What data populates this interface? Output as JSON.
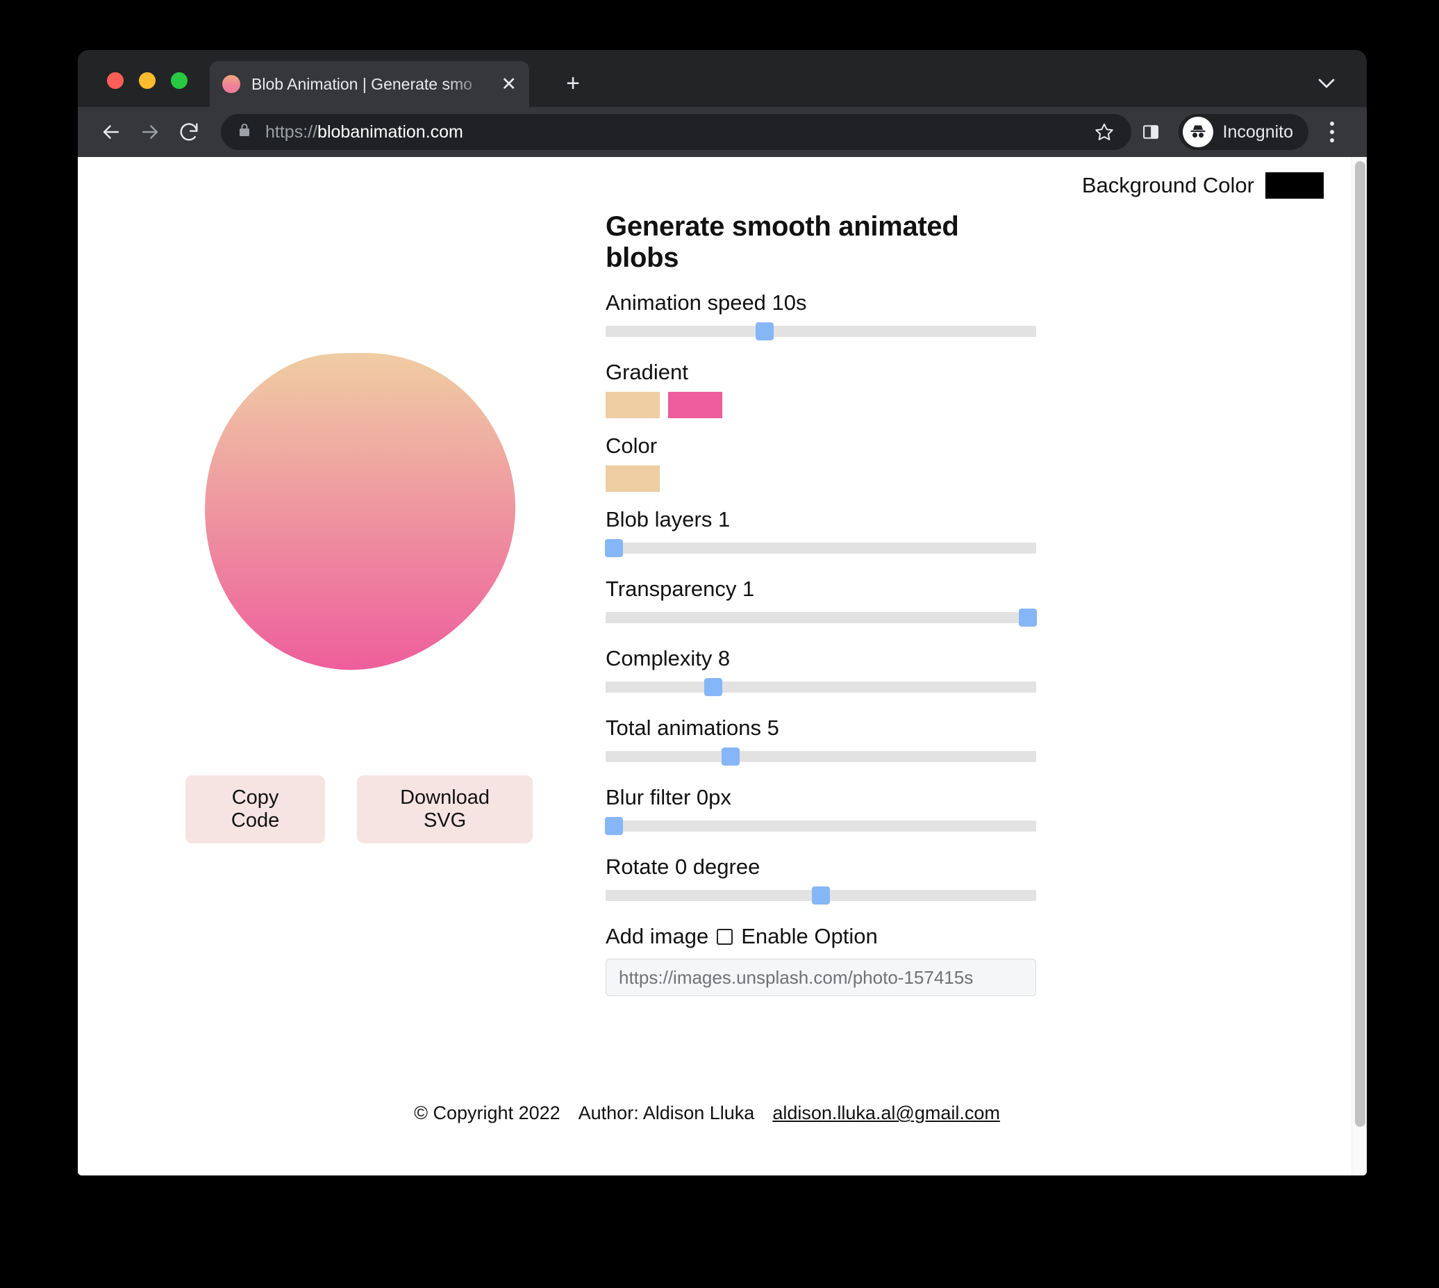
{
  "browser": {
    "tab": {
      "title": "Blob Animation | Generate smo",
      "close_label": "✕"
    },
    "new_tab_label": "+",
    "url": {
      "scheme": "https://",
      "host": "blobanimation.com"
    },
    "profile_label": "Incognito"
  },
  "page": {
    "background_color_label": "Background Color",
    "background_color_value": "#000000",
    "title": "Generate smooth animated blobs",
    "buttons": {
      "copy_code": "Copy Code",
      "download_svg": "Download SVG"
    },
    "blob": {
      "gradient_from": "#EFCDA3",
      "gradient_to": "#EE5E9C"
    },
    "controls": [
      {
        "label": "Animation speed 10s",
        "percent": 37
      },
      {
        "label": "Blob layers 1",
        "percent": 2
      },
      {
        "label": "Transparency 1",
        "percent": 98
      },
      {
        "label": "Complexity 8",
        "percent": 25
      },
      {
        "label": "Total animations 5",
        "percent": 29
      },
      {
        "label": "Blur filter 0px",
        "percent": 2
      },
      {
        "label": "Rotate 0 degree",
        "percent": 50
      }
    ],
    "gradient": {
      "label": "Gradient",
      "stop1": "#EFCDA3",
      "stop2": "#EE5E9C"
    },
    "color": {
      "label": "Color",
      "value": "#EFCDA3"
    },
    "add_image": {
      "label": "Add image",
      "checkbox_label": "Enable Option",
      "checked": false,
      "url_value": "https://images.unsplash.com/photo-157415ѕ"
    },
    "footer": {
      "copyright": "© Copyright 2022",
      "author": "Author: Aldison Lluka",
      "email": "aldison.lluka.al@gmail.com"
    }
  }
}
